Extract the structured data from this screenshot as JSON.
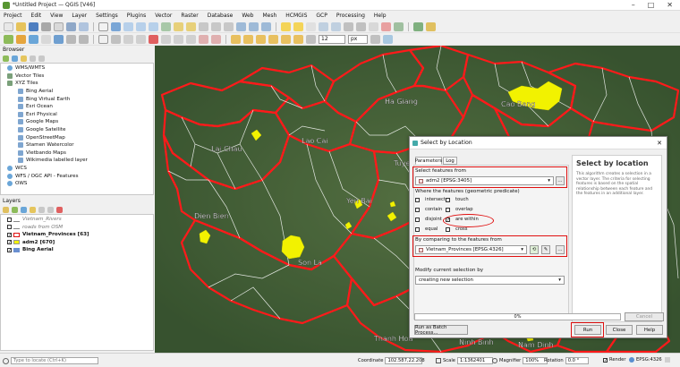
{
  "window": {
    "title": "*Untitled Project — QGIS [V46]",
    "controls": [
      "–",
      "□",
      "✕"
    ]
  },
  "menu": [
    "Project",
    "Edit",
    "View",
    "Layer",
    "Settings",
    "Plugins",
    "Vector",
    "Raster",
    "Database",
    "Web",
    "Mesh",
    "HCMGIS",
    "GCP",
    "Processing",
    "Help"
  ],
  "toolbar": {
    "font_size": "12",
    "unit": "px"
  },
  "browser": {
    "title": "Browser",
    "items": [
      {
        "label": "WMS/WMTS",
        "indent": 0,
        "icon": "globe-icon"
      },
      {
        "label": "Vector Tiles",
        "indent": 0,
        "icon": "grid-icon"
      },
      {
        "label": "XYZ Tiles",
        "indent": 0,
        "icon": "grid-icon"
      },
      {
        "label": "Bing Aerial",
        "indent": 1,
        "icon": "tile-icon"
      },
      {
        "label": "Bing Virtual Earth",
        "indent": 1,
        "icon": "tile-icon"
      },
      {
        "label": "Esri Ocean",
        "indent": 1,
        "icon": "tile-icon"
      },
      {
        "label": "Esri Physical",
        "indent": 1,
        "icon": "tile-icon"
      },
      {
        "label": "Google Maps",
        "indent": 1,
        "icon": "tile-icon"
      },
      {
        "label": "Google Satellite",
        "indent": 1,
        "icon": "tile-icon"
      },
      {
        "label": "OpenStreetMap",
        "indent": 1,
        "icon": "tile-icon"
      },
      {
        "label": "Stamen Watercolor",
        "indent": 1,
        "icon": "tile-icon"
      },
      {
        "label": "Vietbando Maps",
        "indent": 1,
        "icon": "tile-icon"
      },
      {
        "label": "Wikimedia labelled layer",
        "indent": 1,
        "icon": "tile-icon"
      },
      {
        "label": "WCS",
        "indent": 0,
        "icon": "globe-icon"
      },
      {
        "label": "WFS / OGC API - Features",
        "indent": 0,
        "icon": "globe-icon"
      },
      {
        "label": "OWS",
        "indent": 0,
        "icon": "globe-icon"
      }
    ]
  },
  "layers": {
    "title": "Layers",
    "items": [
      {
        "label": "Vietnam_Rivers",
        "style": "italic-gray",
        "checked": false
      },
      {
        "label": "roads from OSM",
        "style": "italic-gray",
        "checked": false
      },
      {
        "label": "Vietnam_Provinces [63]",
        "style": "bold",
        "checked": true
      },
      {
        "label": "adm2 [670]",
        "style": "bold",
        "checked": true
      },
      {
        "label": "Bing Aerial",
        "style": "bold",
        "checked": true
      }
    ]
  },
  "map": {
    "labels": [
      "Ha Giang",
      "Cao Bang",
      "Lai Chau",
      "Lao Cai",
      "Tuye",
      "Yen Bai",
      "Dien Bien",
      "Son La",
      "Thanh Hoa",
      "Ninh Binh",
      "Nam Dinh"
    ]
  },
  "dialog": {
    "title": "Select by Location",
    "tabs": [
      "Parameters",
      "Log"
    ],
    "select_from_label": "Select features from",
    "select_from_value": "adm2 [EPSG:3405]",
    "predicate_label": "Where the features (geometric predicate)",
    "predicates": [
      {
        "label": "intersect",
        "checked": false
      },
      {
        "label": "touch",
        "checked": false
      },
      {
        "label": "contain",
        "checked": false
      },
      {
        "label": "overlap",
        "checked": false
      },
      {
        "label": "disjoint",
        "checked": false
      },
      {
        "label": "are within",
        "checked": true
      },
      {
        "label": "equal",
        "checked": false
      },
      {
        "label": "cross",
        "checked": false
      }
    ],
    "compare_label": "By comparing to the features from",
    "compare_value": "Vietnam_Provinces [EPSG:4326]",
    "modify_label": "Modify current selection by",
    "modify_value": "creating new selection",
    "progress": "0%",
    "progress_value": 0,
    "cancel": "Cancel",
    "batch": "Run as Batch Process...",
    "run": "Run",
    "close": "Close",
    "help": "Help",
    "help_title": "Select by location",
    "help_text": "This algorithm creates a selection in a vector layer. The criteria for selecting features is based on the spatial relationship between each feature and the features in an additional layer."
  },
  "status": {
    "search_placeholder": "Type to locate (Ctrl+K)",
    "coordinate_label": "Coordinate",
    "coordinate_value": "102.587,22.208",
    "scale_label": "Scale",
    "scale_value": "1:1362401",
    "magnifier_label": "Magnifier",
    "magnifier_value": "100%",
    "rotation_label": "Rotation",
    "rotation_value": "0.0 °",
    "render_label": "Render",
    "crs": "EPSG:4326"
  },
  "colors": {
    "accent": "#e01010",
    "highlight": "#f2f200",
    "boundary": "#ff1a1a"
  }
}
